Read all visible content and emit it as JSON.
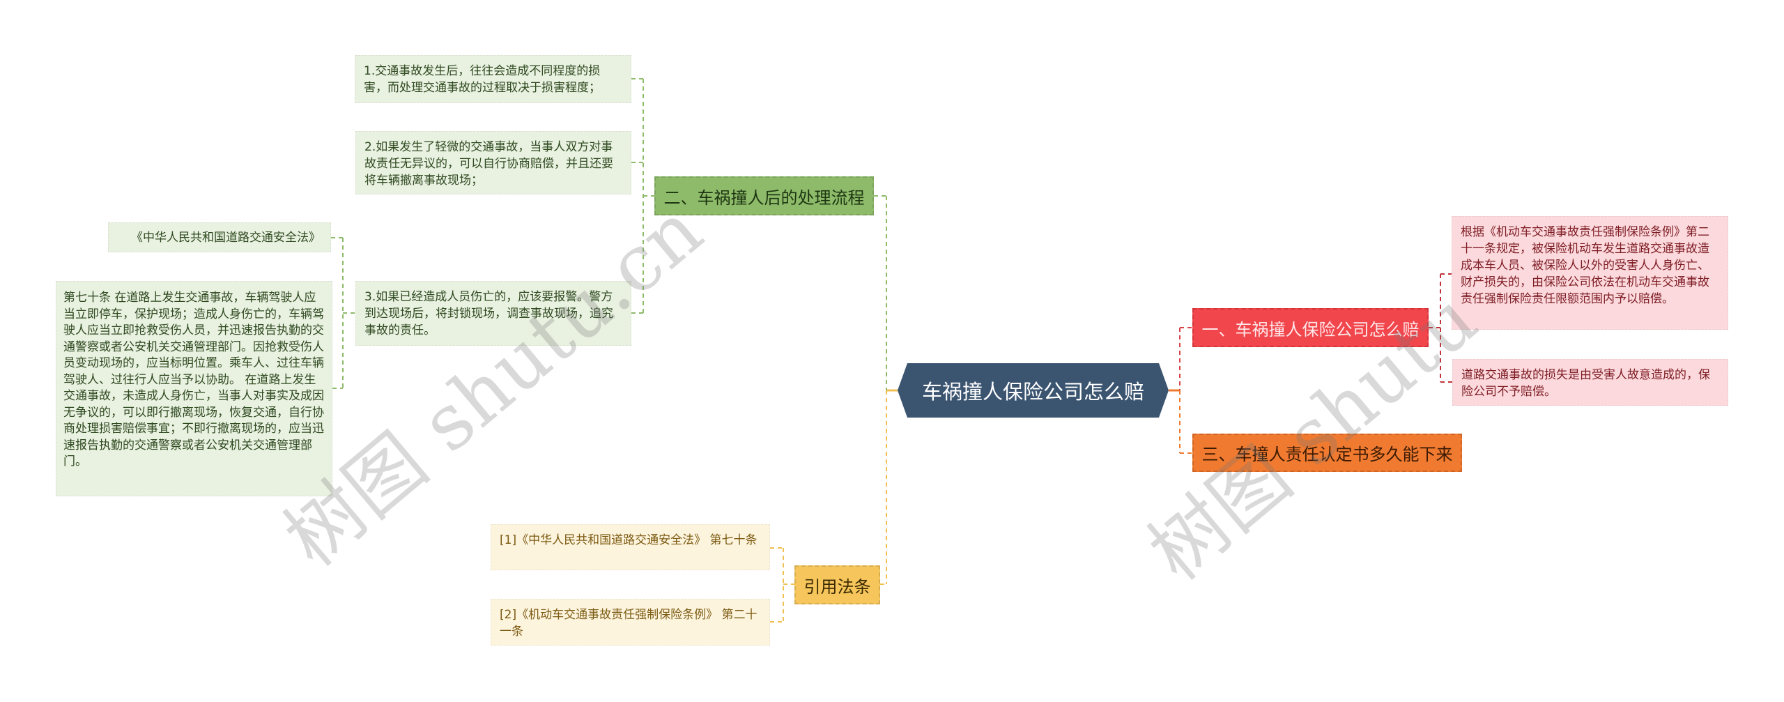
{
  "root": {
    "label": "车祸撞人保险公司怎么赔"
  },
  "branches": {
    "process": {
      "label": "二、车祸撞人后的处理流程",
      "color": "#8dbb6a",
      "steps": [
        "1.交通事故发生后，往往会造成不同程度的损害，而处理交通事故的过程取决于损害程度；",
        "2.如果发生了轻微的交通事故，当事人双方对事故责任无异议的，可以自行协商赔偿，并且还要将车辆撤离事故现场；",
        "3.如果已经造成人员伤亡的，应该要报警。警方到达现场后，将封锁现场，调查事故现场，追究事故的责任。"
      ],
      "law_title": "《中华人民共和国道路交通安全法》",
      "law_article": "第七十条  在道路上发生交通事故，车辆驾驶人应当立即停车，保护现场；造成人身伤亡的，车辆驾驶人应当立即抢救受伤人员，并迅速报告执勤的交通警察或者公安机关交通管理部门。因抢救受伤人员变动现场的，应当标明位置。乘车人、过往车辆驾驶人、过往行人应当予以协助。 在道路上发生交通事故，未造成人身伤亡，当事人对事实及成因无争议的，可以即行撤离现场，恢复交通，自行协商处理损害赔偿事宜；不即行撤离现场的，应当迅速报告执勤的交通警察或者公安机关交通管理部门。"
    },
    "citations": {
      "label": "引用法条",
      "color": "#f6c65c",
      "items": [
        "[1]《中华人民共和国道路交通安全法》 第七十条",
        "[2]《机动车交通事故责任强制保险条例》 第二十一条"
      ]
    },
    "compensation": {
      "label": "一、车祸撞人保险公司怎么赔",
      "color": "#f1464c",
      "items": [
        "根据《机动车交通事故责任强制保险条例》第二十一条规定，被保险机动车发生道路交通事故造成本车人员、被保险人以外的受害人人身伤亡、财产损失的，由保险公司依法在机动车交通事故责任强制保险责任限额范围内予以赔偿。",
        "道路交通事故的损失是由受害人故意造成的，保险公司不予赔偿。"
      ]
    },
    "liability": {
      "label": "三、车撞人责任认定书多久能下来",
      "color": "#f07b30"
    }
  },
  "watermark": {
    "text_left": "树图 shutu.cn",
    "text_right": "树图 shutu"
  }
}
